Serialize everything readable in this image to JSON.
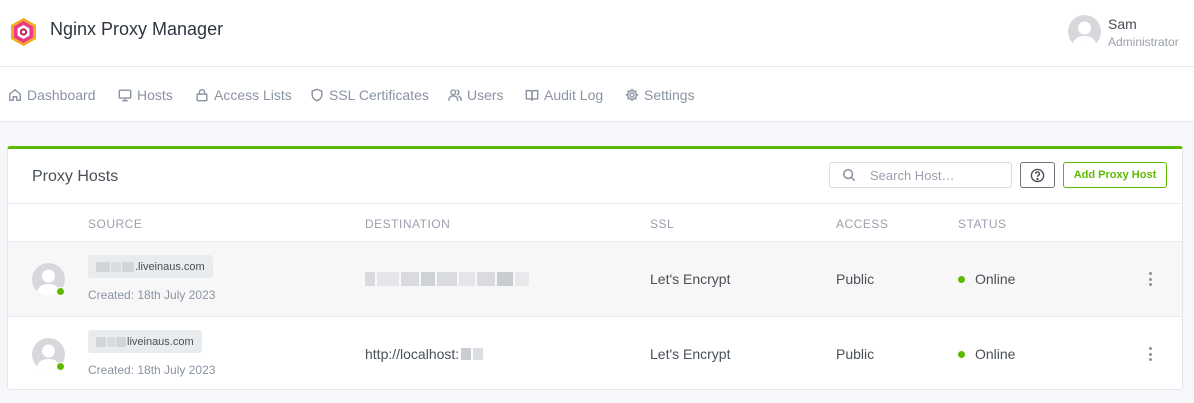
{
  "app": {
    "title": "Nginx Proxy Manager"
  },
  "user": {
    "name": "Sam",
    "role": "Administrator"
  },
  "nav": [
    {
      "label": "Dashboard",
      "icon": "home-icon"
    },
    {
      "label": "Hosts",
      "icon": "monitor-icon"
    },
    {
      "label": "Access Lists",
      "icon": "lock-icon"
    },
    {
      "label": "SSL Certificates",
      "icon": "shield-icon"
    },
    {
      "label": "Users",
      "icon": "users-icon"
    },
    {
      "label": "Audit Log",
      "icon": "book-icon"
    },
    {
      "label": "Settings",
      "icon": "gear-icon"
    }
  ],
  "card": {
    "title": "Proxy Hosts",
    "search_placeholder": "Search Host…",
    "add_label": "Add Proxy Host"
  },
  "table": {
    "columns": [
      "SOURCE",
      "DESTINATION",
      "SSL",
      "ACCESS",
      "STATUS"
    ],
    "rows": [
      {
        "source": ".liveinaus.com",
        "created": "Created: 18th July 2023",
        "destination": "",
        "ssl": "Let's Encrypt",
        "access": "Public",
        "status": "Online"
      },
      {
        "source": "liveinaus.com",
        "created": "Created: 18th July 2023",
        "destination": "http://localhost:",
        "ssl": "Let's Encrypt",
        "access": "Public",
        "status": "Online"
      }
    ]
  },
  "colors": {
    "accent": "#5eba00",
    "online": "#5eba00",
    "logo": "#e8398b"
  }
}
